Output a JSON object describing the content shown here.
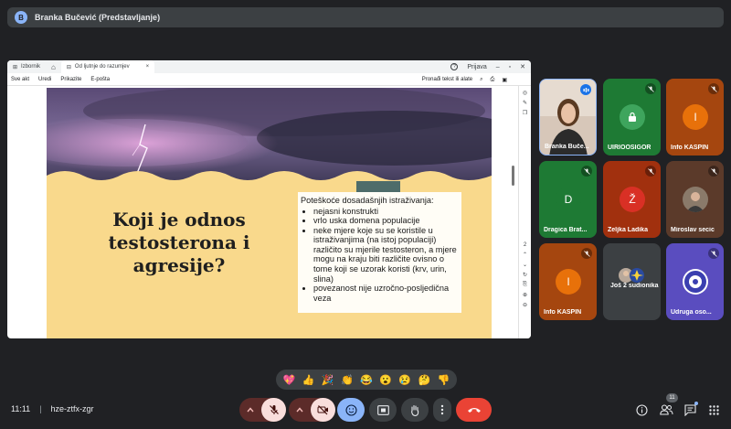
{
  "presenter_bar": {
    "initial": "B",
    "label": "Branka Bučević (Predstavljanje)"
  },
  "shared_window": {
    "tabs": [
      {
        "label": "Izbornik"
      },
      {
        "label": "Od ljutnje do razumjev"
      }
    ],
    "window_controls": {
      "help": "?",
      "login": "Prijava"
    },
    "toolbar": {
      "items": [
        "Sve akt",
        "Uredi",
        "Prikazite",
        "E-pošta"
      ],
      "search_label": "Pronađi tekst ili alate"
    },
    "slide": {
      "title": "Koji je odnos testosterona i agresije?",
      "note_heading": "Poteškoće dosadašnjih istraživanja:",
      "bullets": [
        "nejasni konstrukti",
        "vrlo uska domena populacije",
        "neke mjere koje su se koristile u istraživanjima (na istoj populaciji) različito su mjerile testosteron, a mjere mogu na kraju biti različite ovisno o tome koji se uzorak koristi (krv, urin, slina)",
        "povezanost nije uzročno-posljedična veza"
      ]
    }
  },
  "participants": [
    {
      "name": "Branka Buče...",
      "type": "video",
      "speaking": true
    },
    {
      "name": "UIRIOOSIGOR",
      "type": "icon",
      "icon": "lock-icon",
      "bg": "#1e7a34",
      "muted": true
    },
    {
      "name": "Info KASPIN",
      "type": "initial",
      "initial": "I",
      "bg": "#a5460f",
      "circle": "#e8710a",
      "muted": true
    },
    {
      "name": "Dragica Brat...",
      "type": "initial",
      "initial": "D",
      "bg": "#1e7a34",
      "circle": "#1e7a34",
      "muted": true
    },
    {
      "name": "Željka Ladika",
      "type": "initial",
      "initial": "Ž",
      "bg": "#a1300e",
      "circle": "#d93025",
      "muted": true
    },
    {
      "name": "Miroslav secic",
      "type": "photo",
      "bg": "#5b3a2a",
      "muted": true
    },
    {
      "name": "Info KASPIN",
      "type": "initial",
      "initial": "I",
      "bg": "#a5460f",
      "circle": "#e8710a",
      "muted": true
    },
    {
      "name": "Još 2 sudionika",
      "type": "group",
      "bg": "#3c4043"
    },
    {
      "name": "Udruga oso...",
      "type": "logo",
      "bg": "#5a4dbf",
      "muted": true
    }
  ],
  "reactions": [
    "💖",
    "👍",
    "🎉",
    "👏",
    "😂",
    "😮",
    "😢",
    "🤔",
    "👎"
  ],
  "bottom": {
    "time": "11:11",
    "meeting_code": "hze-ztfx-zgr",
    "participant_count": "11"
  },
  "colors": {
    "end_call": "#ea4335",
    "muted_control": "#f9dedc",
    "active_control": "#8ab4f8"
  }
}
